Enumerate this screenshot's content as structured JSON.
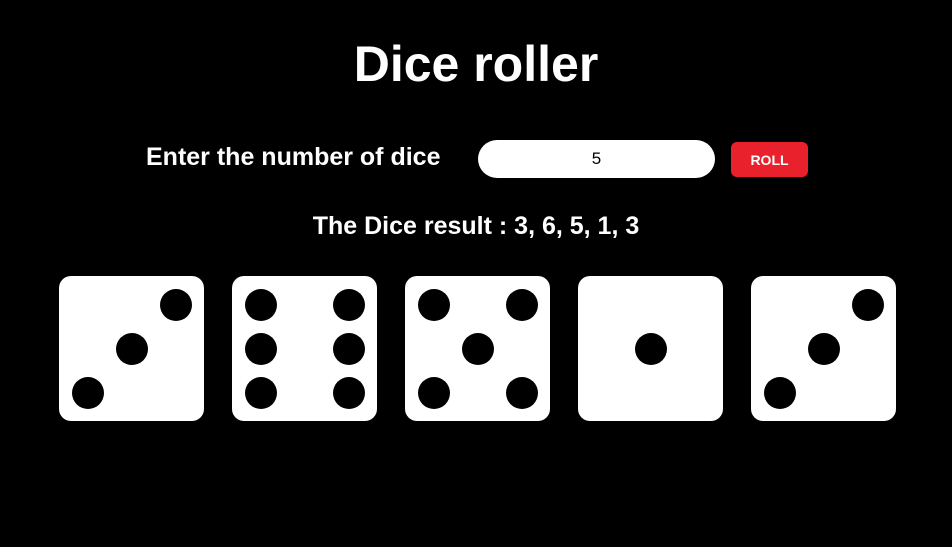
{
  "page": {
    "title": "Dice roller"
  },
  "controls": {
    "count_label": "Enter the number of dice",
    "count_value": "5",
    "roll_label": "ROLL"
  },
  "result": {
    "text": "The Dice result : 3, 6, 5, 1, 3"
  },
  "dice": [
    3,
    6,
    5,
    1,
    3
  ],
  "colors": {
    "background": "#000000",
    "die_face": "#ffffff",
    "pip": "#000000",
    "roll_button": "#e8212d"
  }
}
